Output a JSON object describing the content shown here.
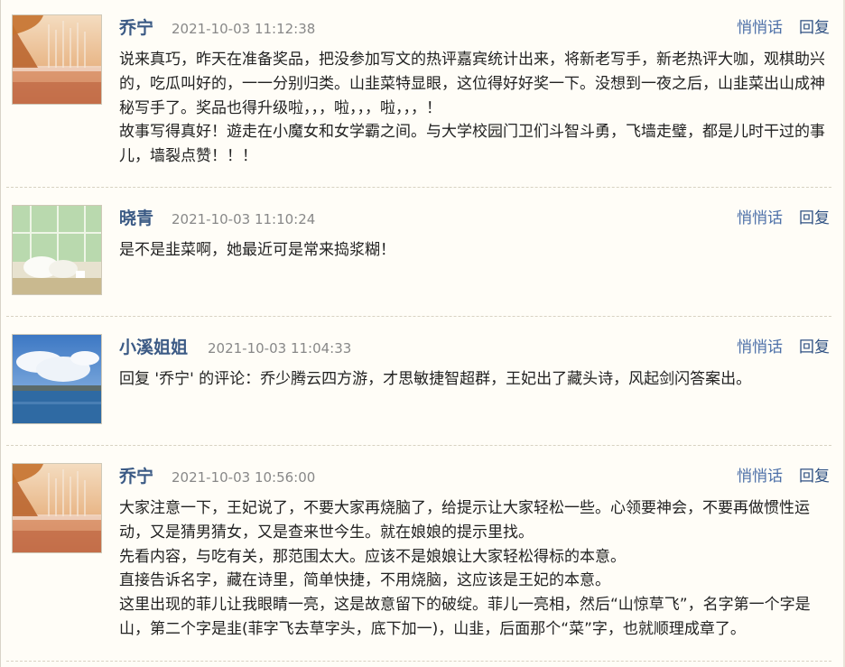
{
  "colors": {
    "background": "#fffdf7",
    "username": "#3b5a85",
    "timestamp": "#888888",
    "whisper_link": "#4d70a8",
    "reply_link": "#2f5183",
    "body_text": "#222222",
    "separator": "#d8d2c2"
  },
  "comments": [
    {
      "username": "乔宁",
      "time": "2021-10-03 11:12:38",
      "whisper_label": "悄悄话",
      "reply_label": "回复",
      "avatar_icon": "autumn-lake-avatar",
      "lines": [
        "说来真巧，昨天在准备奖品，把没参加写文的热评嘉宾统计出来，将新老写手，新老热评大咖，观棋助兴的，吃瓜叫好的，一一分别归类。山韭菜特显眼，这位得好好奖一下。没想到一夜之后，山韭菜出山成神秘写手了。奖品也得升级啦，，，啦，，，啦，，，！",
        "故事写得真好！遊走在小魔女和女学霸之间。与大学校园门卫们斗智斗勇，飞墙走璧，都是儿时干过的事儿，墙裂点赞！！！"
      ]
    },
    {
      "username": "晓青",
      "time": "2021-10-03 11:10:24",
      "whisper_label": "悄悄话",
      "reply_label": "回复",
      "avatar_icon": "window-cushions-avatar",
      "lines": [
        "是不是韭菜啊，她最近可是常来捣浆糊！"
      ]
    },
    {
      "username": "小溪姐姐",
      "time": "2021-10-03 11:04:33",
      "whisper_label": "悄悄话",
      "reply_label": "回复",
      "avatar_icon": "seaside-sky-avatar",
      "lines": [
        "回复 '乔宁' 的评论：乔少腾云四方游，才思敏捷智超群，王妃出了藏头诗，风起剑闪答案出。"
      ]
    },
    {
      "username": "乔宁",
      "time": "2021-10-03 10:56:00",
      "whisper_label": "悄悄话",
      "reply_label": "回复",
      "avatar_icon": "autumn-lake-avatar",
      "lines": [
        "大家注意一下，王妃说了，不要大家再烧脑了，给提示让大家轻松一些。心领要神会，不要再做惯性运动，又是猜男猜女，又是查来世今生。就在娘娘的提示里找。",
        "先看内容，与吃有关，那范围太大。应该不是娘娘让大家轻松得标的本意。",
        "直接告诉名字，藏在诗里，简单快捷，不用烧脑，这应该是王妃的本意。",
        "这里出现的菲儿让我眼睛一亮，这是故意留下的破绽。菲儿一亮相，然后“山惊草飞”，名字第一个字是山，第二个字是韭(菲字飞去草字头，底下加一)，山韭，后面那个“菜”字，也就顺理成章了。"
      ]
    }
  ]
}
